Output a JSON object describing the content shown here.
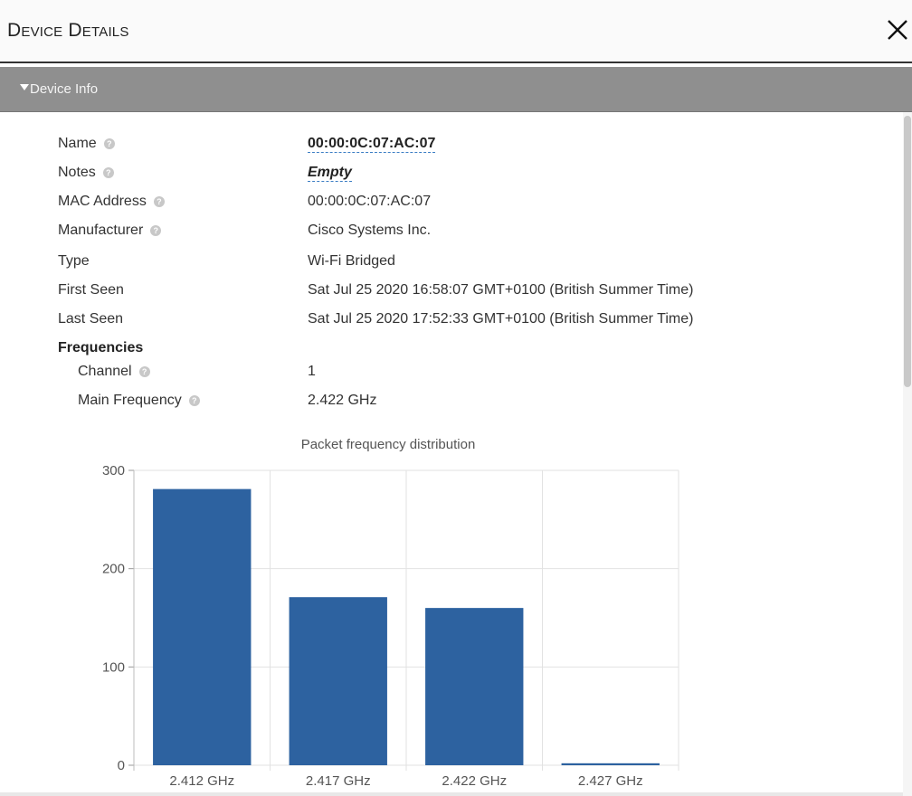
{
  "window": {
    "title": "Device Details"
  },
  "section": {
    "label": "Device Info"
  },
  "device": {
    "rows": [
      {
        "label": "Name",
        "value": "00:00:0C:07:AC:07"
      },
      {
        "label": "Notes",
        "value": "Empty"
      },
      {
        "label": "MAC Address",
        "value": "00:00:0C:07:AC:07"
      },
      {
        "label": "Manufacturer",
        "value": "Cisco Systems Inc."
      },
      {
        "label": "Type",
        "value": "Wi-Fi Bridged"
      },
      {
        "label": "First Seen",
        "value": "Sat Jul 25 2020 16:58:07 GMT+0100 (British Summer Time)"
      },
      {
        "label": "Last Seen",
        "value": "Sat Jul 25 2020 17:52:33 GMT+0100 (British Summer Time)"
      }
    ]
  },
  "frequencies": {
    "title": "Frequencies",
    "rows": [
      {
        "label": "Channel",
        "value": "1"
      },
      {
        "label": "Main Frequency",
        "value": "2.422 GHz"
      }
    ]
  },
  "icons": {
    "close": "close-icon",
    "collapse": "triangle-down-icon",
    "help": "help-circle-icon"
  },
  "chart_data": {
    "type": "bar",
    "title": "Packet frequency distribution",
    "categories": [
      "2.412 GHz",
      "2.417 GHz",
      "2.422 GHz",
      "2.427 GHz"
    ],
    "values": [
      281,
      171,
      160,
      2
    ],
    "ylim": [
      0,
      300
    ],
    "yticks": [
      0,
      100,
      200,
      300
    ],
    "xlabel": "",
    "ylabel": "",
    "grid": true,
    "bar_color": "#2d62a0"
  }
}
